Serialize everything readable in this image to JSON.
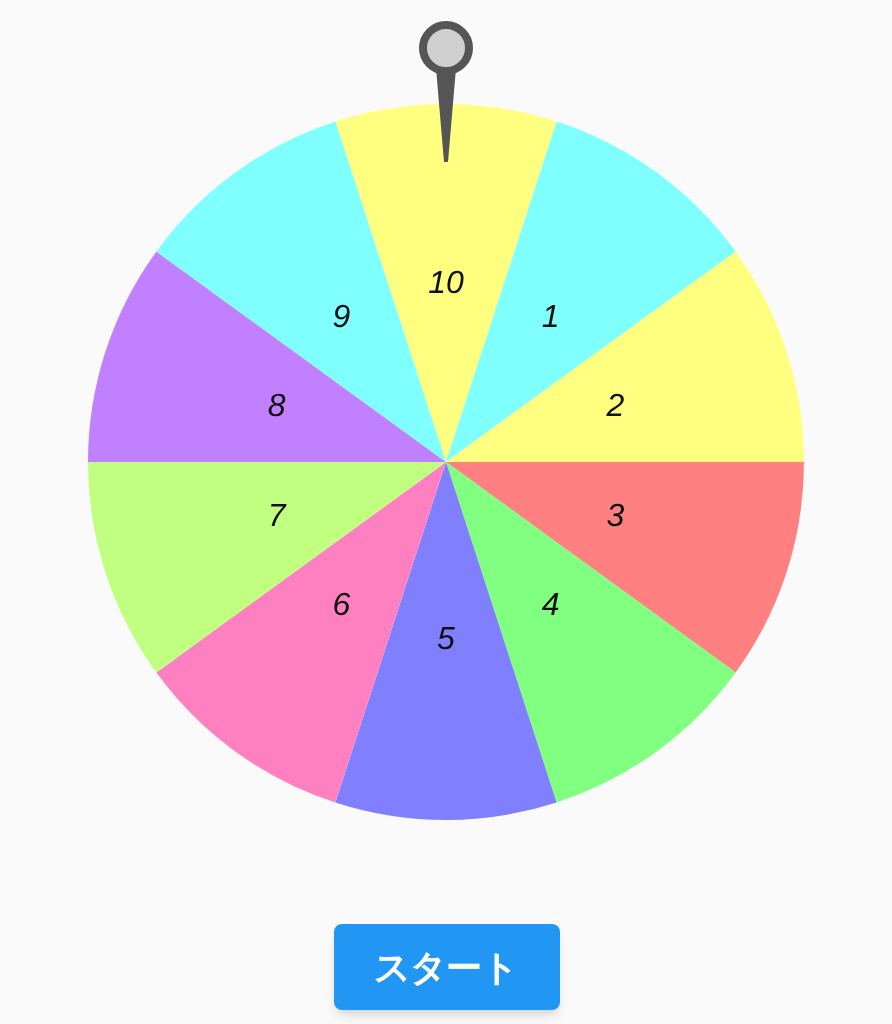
{
  "wheel": {
    "segments": [
      {
        "label": "10",
        "color": "#ffff80"
      },
      {
        "label": "1",
        "color": "#80ffff"
      },
      {
        "label": "2",
        "color": "#ffff80"
      },
      {
        "label": "3",
        "color": "#ff8080"
      },
      {
        "label": "4",
        "color": "#80ff80"
      },
      {
        "label": "5",
        "color": "#8080ff"
      },
      {
        "label": "6",
        "color": "#ff80c0"
      },
      {
        "label": "7",
        "color": "#c0ff80"
      },
      {
        "label": "8",
        "color": "#c080ff"
      },
      {
        "label": "9",
        "color": "#80ffff"
      }
    ]
  },
  "start_button": {
    "label": "スタート"
  }
}
